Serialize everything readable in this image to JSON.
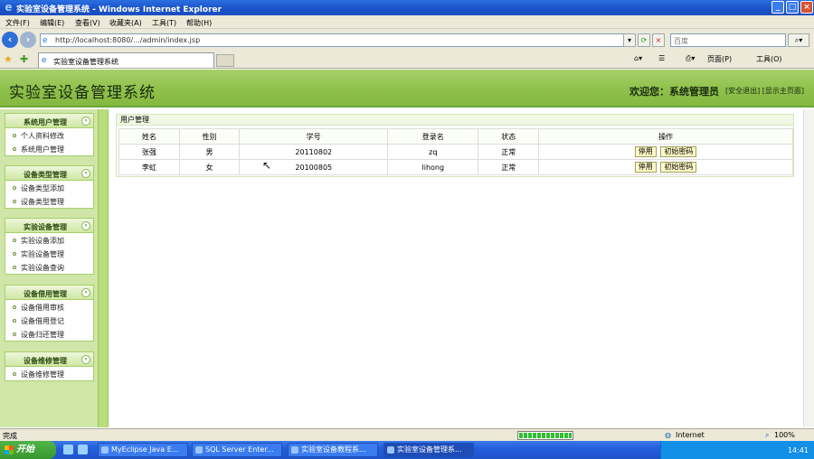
{
  "window": {
    "title": "实验室设备管理系统 - Windows Internet Explorer"
  },
  "menu": [
    "文件(F)",
    "编辑(E)",
    "查看(V)",
    "收藏夹(A)",
    "工具(T)",
    "帮助(H)"
  ],
  "address": {
    "url": "http://localhost:8080/.../admin/index.jsp",
    "search_placeholder": "百度"
  },
  "tab": {
    "label": "实验室设备管理系统"
  },
  "toolbar": {
    "page": "页面(P)",
    "tools": "工具(O)"
  },
  "header": {
    "system_name": "实验室设备管理系统",
    "welcome": "欢迎您：系统管理员",
    "links": "[安全退出] [显示主页面]"
  },
  "sidebar": {
    "groups": [
      {
        "title": "系统用户管理",
        "items": [
          "个人资料修改",
          "系统用户管理"
        ]
      },
      {
        "title": "设备类型管理",
        "items": [
          "设备类型添加",
          "设备类型管理"
        ]
      },
      {
        "title": "实验设备管理",
        "items": [
          "实验设备添加",
          "实验设备管理",
          "实验设备查询"
        ]
      },
      {
        "title": "设备借用管理",
        "items": [
          "设备借用审核",
          "设备借用登记",
          "设备归还管理"
        ]
      },
      {
        "title": "设备维修管理",
        "items": [
          "设备维修管理"
        ]
      }
    ]
  },
  "main": {
    "panel_title": "用户管理",
    "columns": [
      "姓名",
      "性别",
      "学号",
      "登录名",
      "状态",
      "操作"
    ],
    "rows": [
      {
        "name": "张强",
        "gender": "男",
        "student_no": "20110802",
        "login": "zq",
        "status": "正常",
        "actions": [
          "停用",
          "初始密码"
        ]
      },
      {
        "name": "李虹",
        "gender": "女",
        "student_no": "20100805",
        "login": "lihong",
        "status": "正常",
        "actions": [
          "停用",
          "初始密码"
        ]
      }
    ]
  },
  "status": {
    "text": "完成",
    "zone": "Internet",
    "zoom": "100%"
  },
  "taskbar": {
    "start": "开始",
    "tasks": [
      "MyEclipse Java E...",
      "SQL Server Enter...",
      "实验室设备教程系...",
      "实验室设备管理系..."
    ],
    "clock": "14:41"
  }
}
